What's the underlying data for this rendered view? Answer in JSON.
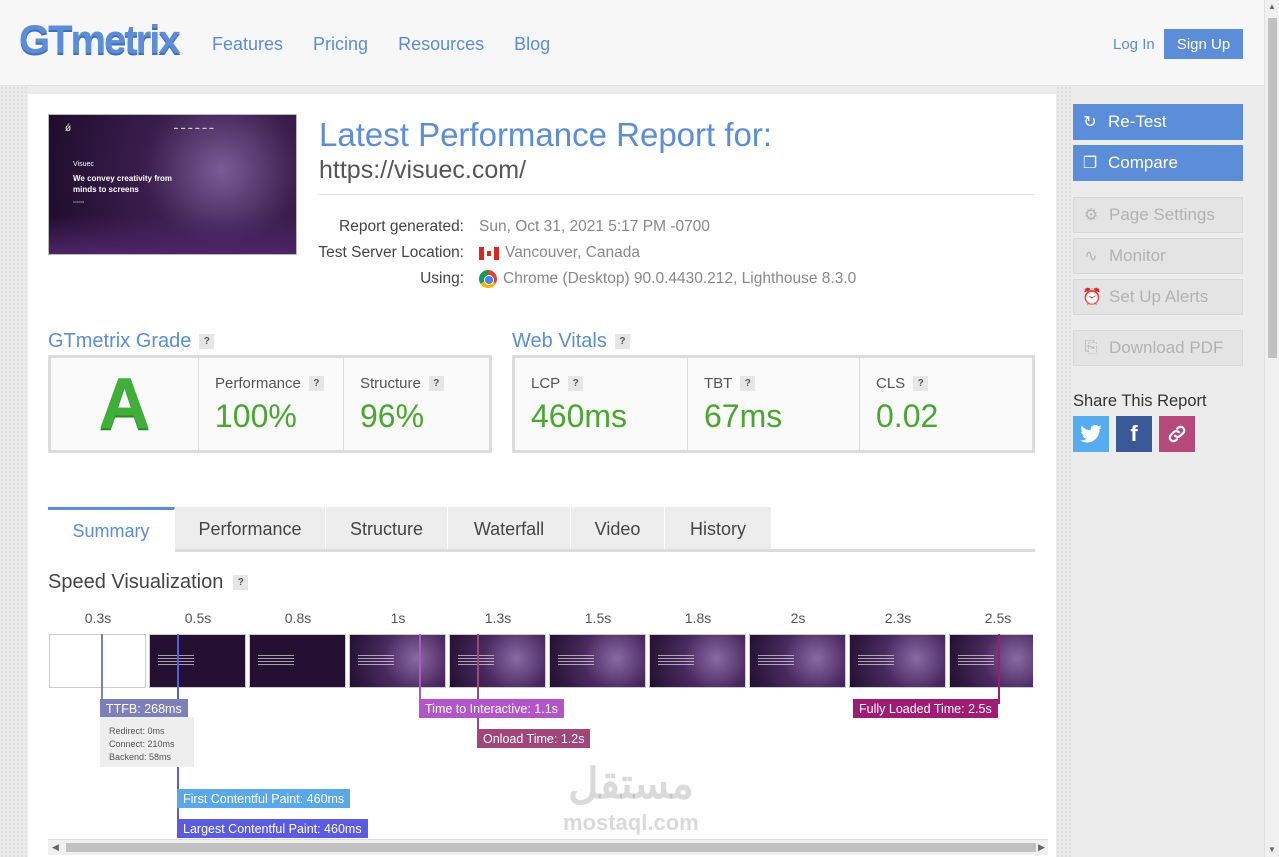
{
  "header": {
    "logo": "GTmetrix",
    "nav": [
      "Features",
      "Pricing",
      "Resources",
      "Blog"
    ],
    "login": "Log In",
    "signup": "Sign Up"
  },
  "thumbnail": {
    "brand": "Visuec",
    "headline": "We convey creativity from minds to screens"
  },
  "report": {
    "title": "Latest Performance Report for:",
    "url": "https://visuec.com/",
    "meta": [
      {
        "label": "Report generated:",
        "value": "Sun, Oct 31, 2021 5:17 PM -0700"
      },
      {
        "label": "Test Server Location:",
        "value": "Vancouver, Canada",
        "icon": "canada-flag-icon"
      },
      {
        "label": "Using:",
        "value": "Chrome (Desktop) 90.0.4430.212, Lighthouse 8.3.0",
        "icon": "chrome-icon"
      }
    ]
  },
  "grade": {
    "title": "GTmetrix Grade",
    "letter": "A",
    "performance_label": "Performance",
    "performance_value": "100%",
    "structure_label": "Structure",
    "structure_value": "96%"
  },
  "vitals": {
    "title": "Web Vitals",
    "lcp_label": "LCP",
    "lcp_value": "460ms",
    "tbt_label": "TBT",
    "tbt_value": "67ms",
    "cls_label": "CLS",
    "cls_value": "0.02"
  },
  "help_mark": "?",
  "tabs": [
    "Summary",
    "Performance",
    "Structure",
    "Waterfall",
    "Video",
    "History"
  ],
  "speed": {
    "title": "Speed Visualization",
    "times": [
      "0.3s",
      "0.5s",
      "0.8s",
      "1s",
      "1.3s",
      "1.5s",
      "1.8s",
      "2s",
      "2.3s",
      "2.5s"
    ],
    "markers": {
      "ttfb": "TTFB: 268ms",
      "ttfb_redirect": "Redirect: 0ms",
      "ttfb_connect": "Connect: 210ms",
      "ttfb_backend": "Backend: 58ms",
      "tti": "Time to Interactive: 1.1s",
      "onload": "Onload Time: 1.2s",
      "fully_loaded": "Fully Loaded Time: 2.5s",
      "fcp": "First Contentful Paint: 460ms",
      "lcp": "Largest Contentful Paint: 460ms"
    }
  },
  "sidebar": {
    "retest": "Re-Test",
    "compare": "Compare",
    "page_settings": "Page Settings",
    "monitor": "Monitor",
    "alerts": "Set Up Alerts",
    "pdf": "Download PDF",
    "share_title": "Share This Report"
  },
  "watermark": {
    "arabic": "مستقل",
    "latin": "mostaql.com"
  },
  "colors": {
    "accent": "#5b8dd8",
    "green": "#47a72f",
    "ttfb": "#7e7eb8",
    "tti": "#b355c9",
    "onload": "#a0467a",
    "fully_loaded": "#a01c74",
    "fcp": "#5aa8e8",
    "lcp": "#5b5be0"
  }
}
